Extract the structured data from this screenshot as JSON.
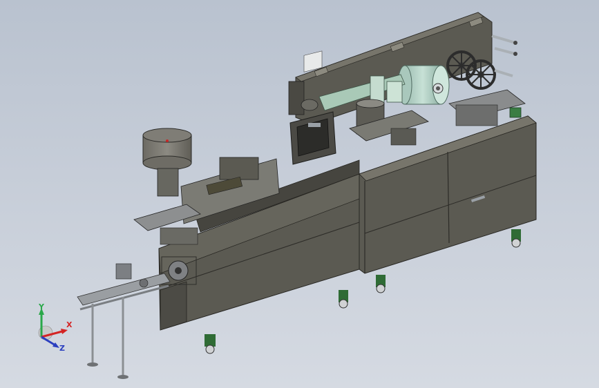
{
  "viewport": {
    "background_top": "#b9c2cf",
    "background_bottom": "#d5dae2"
  },
  "model": {
    "body_color": "#5b5a52",
    "body_dark": "#46453f",
    "body_light": "#77756b",
    "metal": "#9aa0a6",
    "roll_color": "#b5d2c6",
    "green_part": "#3a7d43",
    "hmi_icon": "touch-panel-icon"
  },
  "triad": {
    "x_label": "X",
    "y_label": "Y",
    "z_label": "Z",
    "x_color": "#d42424",
    "y_color": "#2aa84a",
    "z_color": "#2b3fbf"
  }
}
